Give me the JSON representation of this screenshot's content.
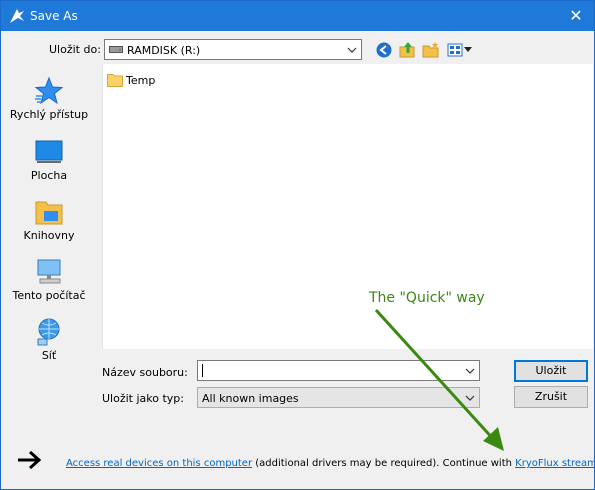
{
  "window": {
    "title": "Save As",
    "close_label": "✕"
  },
  "location": {
    "label": "Uložit do:",
    "value": "RAMDISK (R:)"
  },
  "toolbar": {
    "icons": [
      "back-icon",
      "up-folder-icon",
      "new-folder-icon",
      "view-menu-icon"
    ]
  },
  "sidebar": {
    "items": [
      {
        "label": "Rychlý přístup",
        "icon": "quick-access-icon"
      },
      {
        "label": "Plocha",
        "icon": "desktop-icon"
      },
      {
        "label": "Knihovny",
        "icon": "libraries-icon"
      },
      {
        "label": "Tento počítač",
        "icon": "this-pc-icon"
      },
      {
        "label": "Síť",
        "icon": "network-icon"
      }
    ]
  },
  "files": [
    {
      "name": "Temp",
      "icon": "folder-icon"
    }
  ],
  "filename": {
    "label": "Název souboru:",
    "value": ""
  },
  "filetype": {
    "label": "Uložit jako typ:",
    "value": "All known images"
  },
  "buttons": {
    "save": "Uložit",
    "cancel": "Zrušit"
  },
  "annotation": {
    "text": "The \"Quick\" way",
    "color": "#3a8a12"
  },
  "footer": {
    "link1": "Access real devices on this computer",
    "middle": " (additional drivers may be required). Continue with ",
    "link2": "KryoFlux streams",
    "end": "."
  }
}
